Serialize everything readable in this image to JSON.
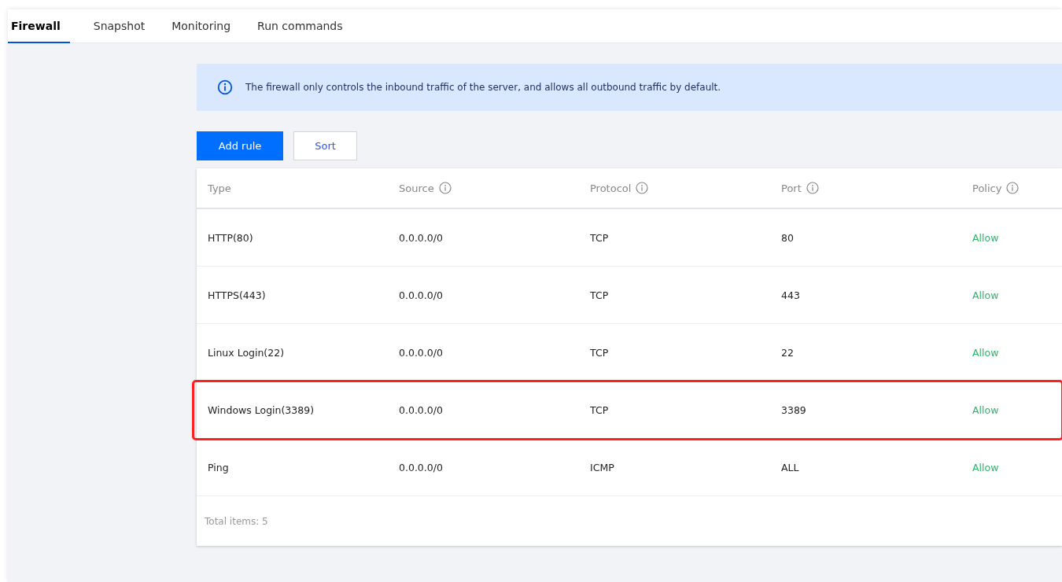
{
  "tabs": [
    {
      "label": "Firewall",
      "selected": true
    },
    {
      "label": "Snapshot",
      "selected": false
    },
    {
      "label": "Monitoring",
      "selected": false
    },
    {
      "label": "Run commands",
      "selected": false
    }
  ],
  "notice": {
    "text": "The firewall only controls the inbound traffic of the server, and allows all outbound traffic by default."
  },
  "buttons": [
    {
      "label": "Add rule",
      "kind": "primary"
    },
    {
      "label": "Sort",
      "kind": "secondary"
    }
  ],
  "table": {
    "columns": [
      {
        "label": "Type",
        "info": false
      },
      {
        "label": "Source",
        "info": true
      },
      {
        "label": "Protocol",
        "info": true
      },
      {
        "label": "Port",
        "info": true
      },
      {
        "label": "Policy",
        "info": true
      }
    ],
    "rows": [
      {
        "cells": [
          "HTTP(80)",
          "0.0.0.0/0",
          "TCP",
          "80",
          "Allow"
        ],
        "highlighted": false
      },
      {
        "cells": [
          "HTTPS(443)",
          "0.0.0.0/0",
          "TCP",
          "443",
          "Allow"
        ],
        "highlighted": false
      },
      {
        "cells": [
          "Linux Login(22)",
          "0.0.0.0/0",
          "TCP",
          "22",
          "Allow"
        ],
        "highlighted": false
      },
      {
        "cells": [
          "Windows Login(3389)",
          "0.0.0.0/0",
          "TCP",
          "3389",
          "Allow"
        ],
        "highlighted": true
      },
      {
        "cells": [
          "Ping",
          "0.0.0.0/0",
          "ICMP",
          "ALL",
          "Allow"
        ],
        "highlighted": false
      }
    ],
    "footer": "Total items:  5"
  }
}
